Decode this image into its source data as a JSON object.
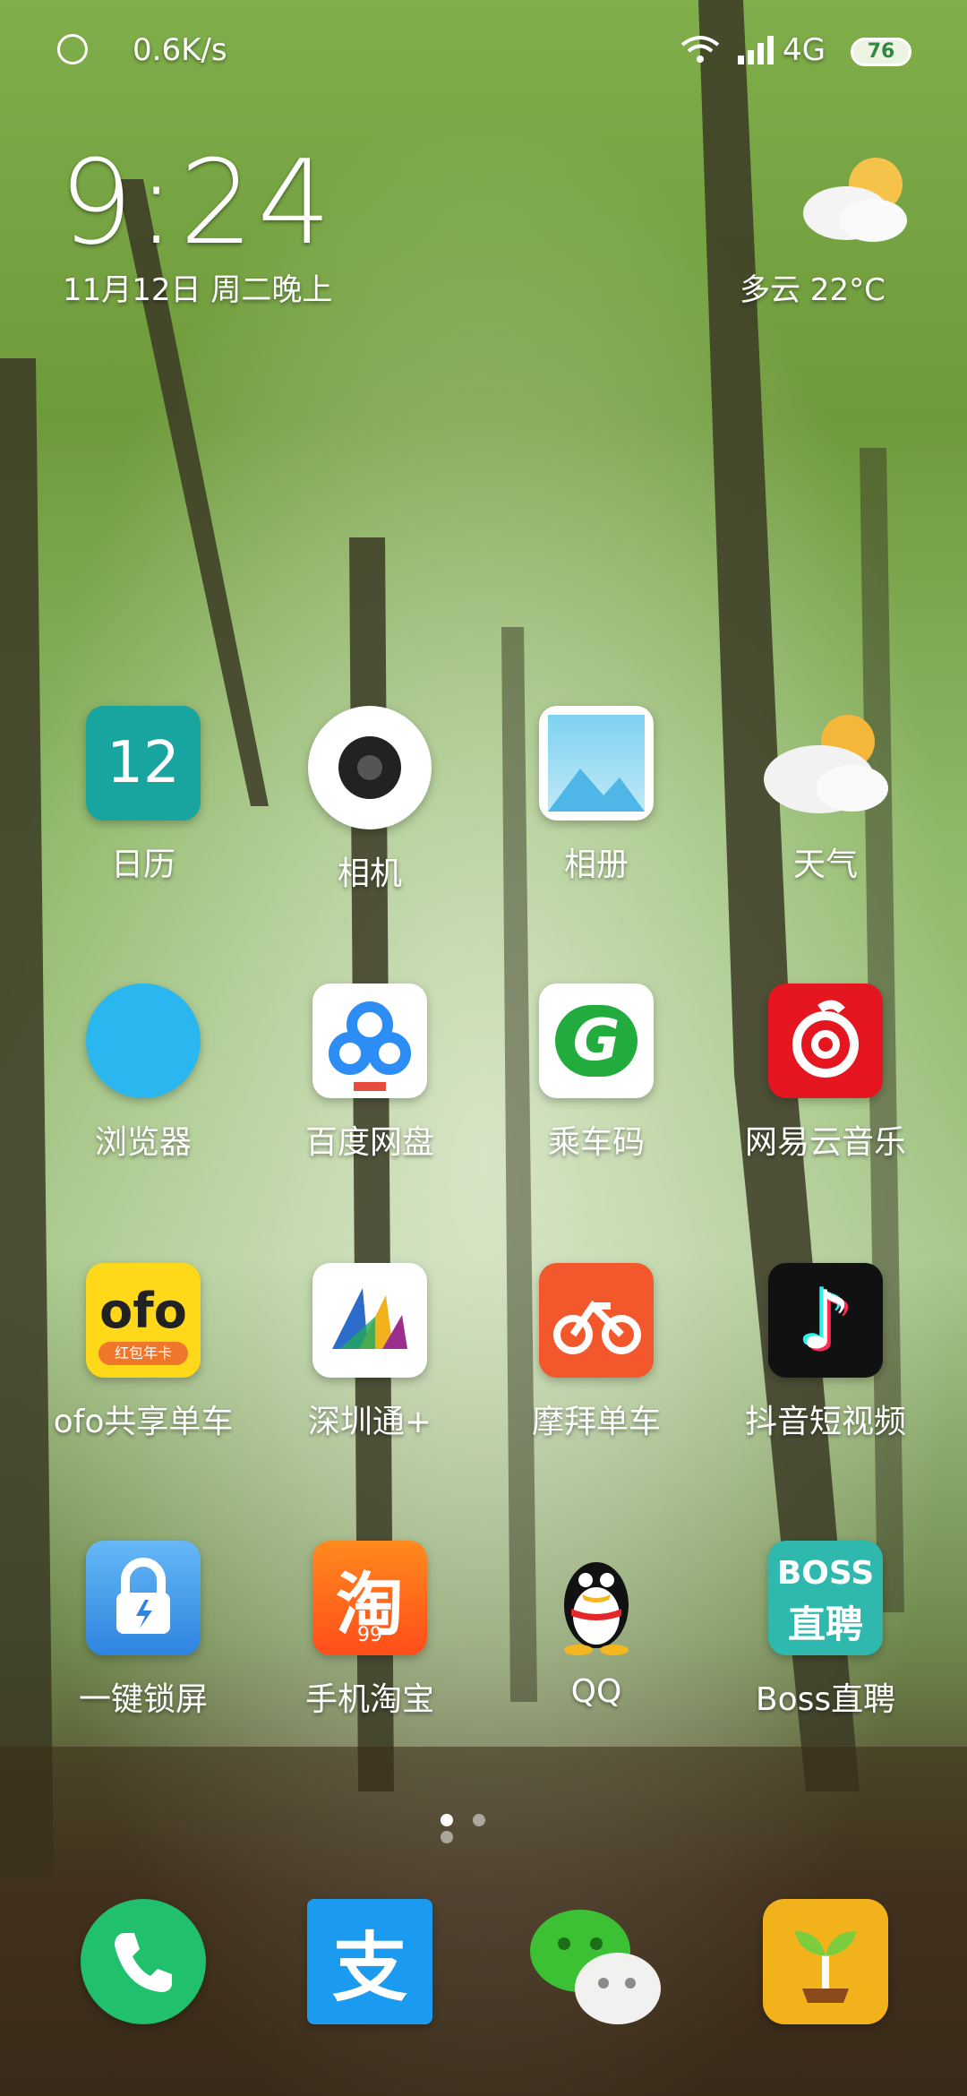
{
  "status_bar": {
    "net_speed": "0.6K/s",
    "network": "4G",
    "battery": "76"
  },
  "lockscreen_widget": {
    "time": "9:24",
    "date": "11月12日 周二晚上",
    "weather": "多云  22°C",
    "weather_icon": "partly-cloudy-icon"
  },
  "apps": [
    {
      "label": "日历",
      "icon": "calendar-icon",
      "badge": "12"
    },
    {
      "label": "相机",
      "icon": "camera-icon"
    },
    {
      "label": "相册",
      "icon": "gallery-icon"
    },
    {
      "label": "天气",
      "icon": "weather-icon"
    },
    {
      "label": "浏览器",
      "icon": "browser-icon"
    },
    {
      "label": "百度网盘",
      "icon": "baidu-netdisk-icon"
    },
    {
      "label": "乘车码",
      "icon": "ride-code-icon",
      "glyph": "G"
    },
    {
      "label": "网易云音乐",
      "icon": "netease-music-icon"
    },
    {
      "label": "ofo共享单车",
      "icon": "ofo-icon",
      "glyph": "ofo",
      "sub": "红包年卡"
    },
    {
      "label": "深圳通+",
      "icon": "shenzhentong-icon"
    },
    {
      "label": "摩拜单车",
      "icon": "mobike-icon"
    },
    {
      "label": "抖音短视频",
      "icon": "douyin-icon",
      "glyph": "♪"
    },
    {
      "label": "一键锁屏",
      "icon": "lock-screen-icon"
    },
    {
      "label": "手机淘宝",
      "icon": "taobao-icon",
      "glyph": "淘",
      "sub": "99"
    },
    {
      "label": "QQ",
      "icon": "qq-icon"
    },
    {
      "label": "Boss直聘",
      "icon": "boss-zhipin-icon",
      "glyph": "BOSS",
      "sub": "直聘"
    }
  ],
  "dock": [
    {
      "icon": "phone-icon"
    },
    {
      "icon": "alipay-icon",
      "glyph": "支"
    },
    {
      "icon": "wechat-icon"
    },
    {
      "icon": "sprout-icon"
    }
  ],
  "page_indicator": {
    "pages": 3,
    "active": 1
  }
}
